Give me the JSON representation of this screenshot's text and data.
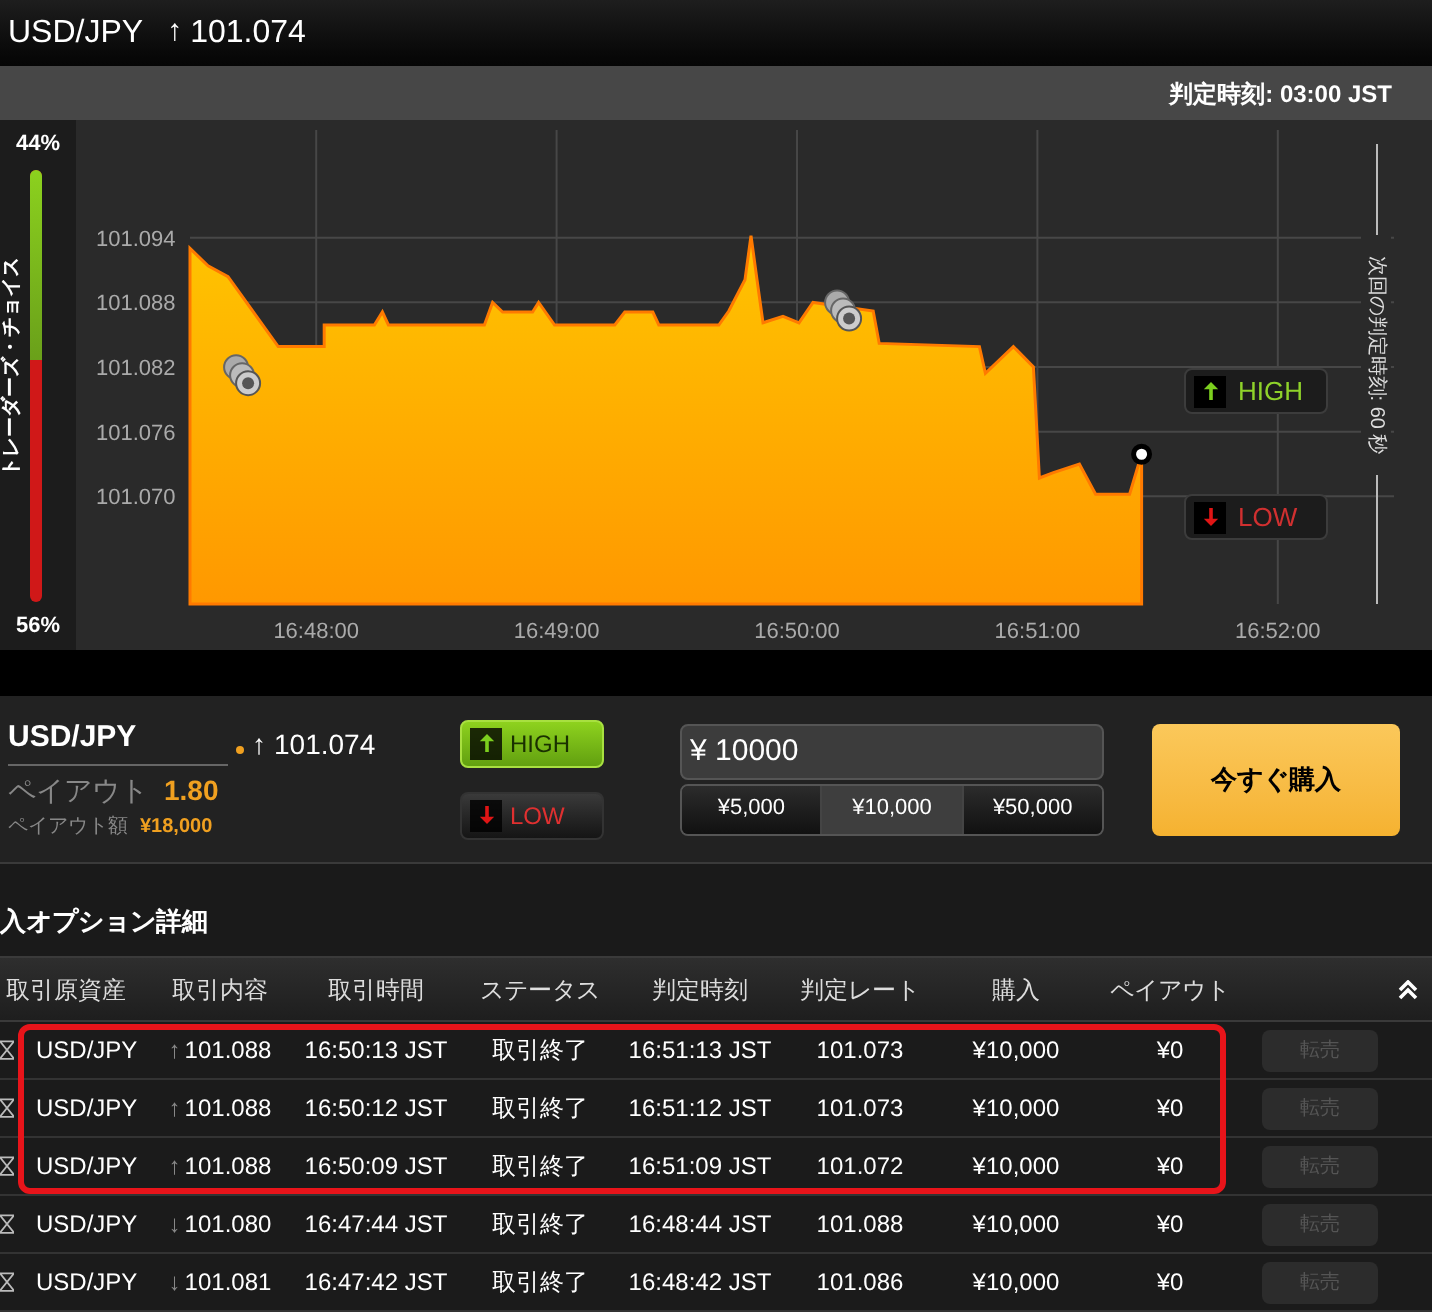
{
  "header": {
    "pair": "USD/JPY",
    "arrow": "↑",
    "rate": "101.074"
  },
  "expiry_bar": {
    "text": "判定時刻: 03:00 JST"
  },
  "traders_choice": {
    "label": "トレーダーズ・チョイス",
    "high_percent": "44%",
    "low_percent": "56%",
    "level": 0.44
  },
  "chart": {
    "next_expiry": "次回の判定時刻: 60 秒",
    "high_button": "HIGH",
    "low_button": "LOW",
    "chart_data": {
      "type": "area",
      "x": [
        60448.5,
        60453,
        60458,
        60470.5,
        60482,
        60482,
        60494.5,
        60496.5,
        60498,
        60522,
        60524,
        60526.5,
        60534,
        60535.5,
        60539.5,
        60554.5,
        60557,
        60564,
        60565.5,
        60580.5,
        60583,
        60587,
        60588.5,
        60590,
        60591.5,
        60596.5,
        60600.5,
        60604,
        60619,
        60620.5,
        60645.5,
        60647,
        60654,
        60659,
        60660.5,
        60664,
        60670.5,
        60674.5,
        60683,
        60686
      ],
      "series": [
        {
          "color": "#ff7a00",
          "values": [
            101.093,
            101.0914,
            101.0904,
            101.0839,
            101.0839,
            101.0859,
            101.0859,
            101.0871,
            101.0859,
            101.0859,
            101.088,
            101.0871,
            101.0871,
            101.088,
            101.0859,
            101.0859,
            101.0871,
            101.0871,
            101.0859,
            101.0859,
            101.0872,
            101.0901,
            101.0942,
            101.0901,
            101.0861,
            101.0867,
            101.0861,
            101.088,
            101.0872,
            101.0842,
            101.0839,
            101.0814,
            101.0839,
            101.082,
            101.0717,
            101.0722,
            101.073,
            101.0702,
            101.0702,
            101.0739
          ]
        }
      ],
      "xlim": [
        60448.5,
        60749
      ],
      "ylim": [
        101.06,
        101.104
      ],
      "grid": true,
      "xticks": [
        {
          "value": 60480,
          "label": "16:48:00"
        },
        {
          "value": 60540,
          "label": "16:49:00"
        },
        {
          "value": 60600,
          "label": "16:50:00"
        },
        {
          "value": 60660,
          "label": "16:51:00"
        },
        {
          "value": 60720,
          "label": "16:52:00"
        }
      ],
      "yticks": [
        {
          "value": 101.094,
          "label": "101.094"
        },
        {
          "value": 101.088,
          "label": "101.088"
        },
        {
          "value": 101.082,
          "label": "101.082"
        },
        {
          "value": 101.076,
          "label": "101.076"
        },
        {
          "value": 101.07,
          "label": "101.070"
        }
      ]
    }
  },
  "order": {
    "pair": "USD/JPY",
    "arrow": "↑",
    "rate": "101.074",
    "payout_label": "ペイアウト",
    "payout": "1.80",
    "payout_amount_label": "ペイアウト額",
    "payout_amount": "¥18,000",
    "options": [
      {
        "label": "HIGH",
        "kind": "high",
        "selected": true
      },
      {
        "label": "LOW",
        "kind": "low",
        "selected": false
      }
    ],
    "amount": "¥ 10000",
    "presets": [
      {
        "label": "¥5,000",
        "selected": false
      },
      {
        "label": "¥10,000",
        "selected": true
      },
      {
        "label": "¥50,000",
        "selected": false
      }
    ],
    "buy_button": "今すぐ購入"
  },
  "section_title": "入オプション詳細",
  "table": {
    "columns": [
      "取引原資産",
      "取引内容",
      "取引時間",
      "ステータス",
      "判定時刻",
      "判定レート",
      "購入",
      "ペイアウト"
    ],
    "rows": [
      {
        "asset": "USD/JPY",
        "arrow": "↑",
        "rate": "101.088",
        "time": "16:50:13 JST",
        "status": "取引終了",
        "expiry": "16:51:13 JST",
        "expiry_rate": "101.073",
        "amount": "¥10,000",
        "payout": "¥0",
        "sell": "転売",
        "disabled": true,
        "highlighted": true
      },
      {
        "asset": "USD/JPY",
        "arrow": "↑",
        "rate": "101.088",
        "time": "16:50:12 JST",
        "status": "取引終了",
        "expiry": "16:51:12 JST",
        "expiry_rate": "101.073",
        "amount": "¥10,000",
        "payout": "¥0",
        "sell": "転売",
        "disabled": true,
        "highlighted": true
      },
      {
        "asset": "USD/JPY",
        "arrow": "↑",
        "rate": "101.088",
        "time": "16:50:09 JST",
        "status": "取引終了",
        "expiry": "16:51:09 JST",
        "expiry_rate": "101.072",
        "amount": "¥10,000",
        "payout": "¥0",
        "sell": "転売",
        "disabled": true,
        "highlighted": true
      },
      {
        "asset": "USD/JPY",
        "arrow": "↓",
        "rate": "101.080",
        "time": "16:47:44 JST",
        "status": "取引終了",
        "expiry": "16:48:44 JST",
        "expiry_rate": "101.088",
        "amount": "¥10,000",
        "payout": "¥0",
        "sell": "転売",
        "disabled": true,
        "highlighted": false
      },
      {
        "asset": "USD/JPY",
        "arrow": "↓",
        "rate": "101.081",
        "time": "16:47:42 JST",
        "status": "取引終了",
        "expiry": "16:48:42 JST",
        "expiry_rate": "101.086",
        "amount": "¥10,000",
        "payout": "¥0",
        "sell": "転売",
        "disabled": true,
        "highlighted": false
      }
    ]
  }
}
